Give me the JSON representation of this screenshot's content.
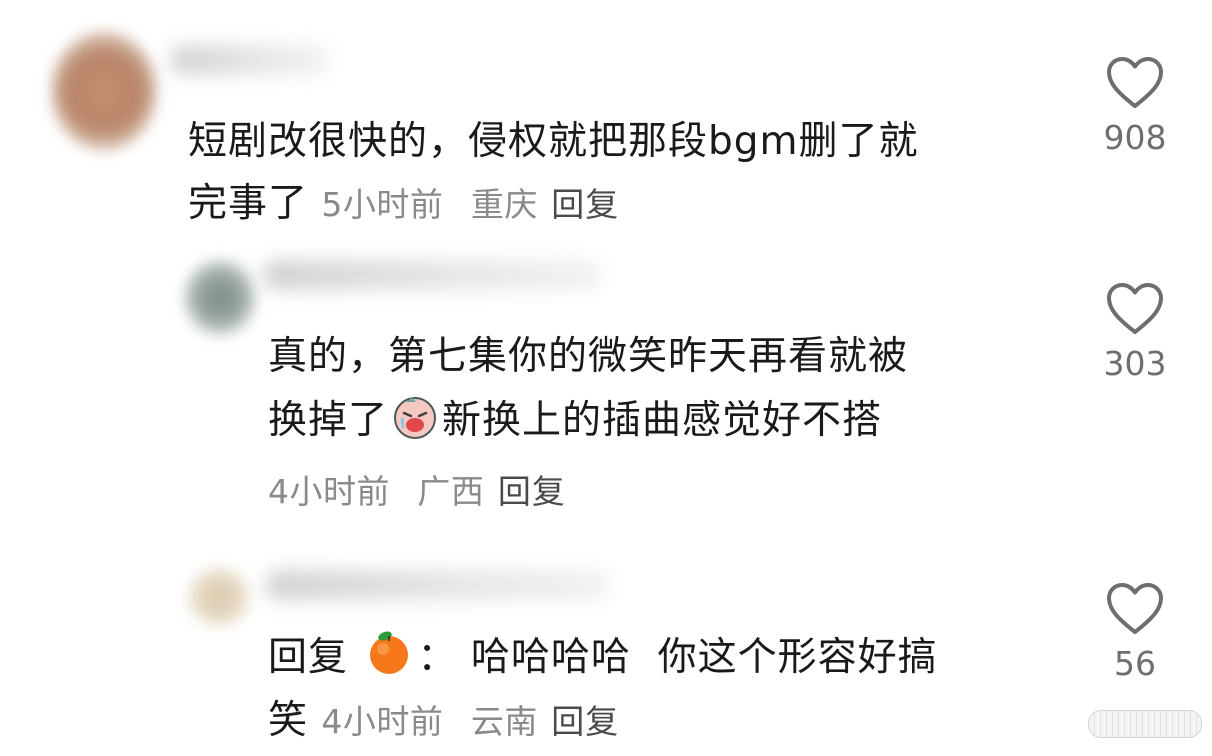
{
  "comments": [
    {
      "text_line1": "短剧改很快的，侵权就把那段bgm删了就",
      "text_line2": "完事了",
      "time": "5小时前",
      "location": "重庆",
      "reply_label": "回复",
      "likes": "908"
    },
    {
      "text_line1": "真的，第七集你的微笑昨天再看就被",
      "text_line2_a": "换掉了",
      "emoji": "crying-face-emoji",
      "text_line2_b": "新换上的插曲感觉好不搭",
      "time": "4小时前",
      "location": "广西",
      "reply_label": "回复",
      "likes": "303"
    },
    {
      "prefix": "回复",
      "mention_emoji": "orange-emoji",
      "colon": "：",
      "text_line1": "哈哈哈哈  你这个形容好搞",
      "text_line2": "笑",
      "time": "4小时前",
      "location": "云南",
      "reply_label": "回复",
      "likes": "56"
    }
  ],
  "icons": {
    "like": "heart-outline-icon"
  },
  "colors": {
    "text": "#1a1a1a",
    "meta": "#8a8a8a",
    "icon": "#6e6e6e"
  }
}
